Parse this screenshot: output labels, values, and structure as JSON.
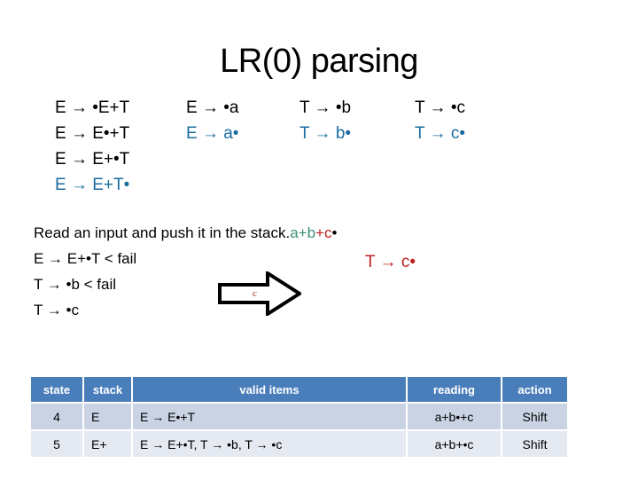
{
  "slide": {
    "title": "LR(0) parsing"
  },
  "itemsets": {
    "columns": [
      {
        "name": "column-e-items",
        "rules": [
          {
            "text": "E → •E+T",
            "color": "black"
          },
          {
            "text": "E → E•+T",
            "color": "black"
          },
          {
            "text": "E → E+•T",
            "color": "black"
          },
          {
            "text": "E → E+T•",
            "color": "blue"
          }
        ]
      },
      {
        "name": "column-a-items",
        "rules": [
          {
            "text": "E → •a",
            "color": "black"
          },
          {
            "text": "E → a•",
            "color": "blue"
          }
        ]
      },
      {
        "name": "column-b-items",
        "rules": [
          {
            "text": "T → •b",
            "color": "black"
          },
          {
            "text": "T → b•",
            "color": "blue"
          }
        ]
      },
      {
        "name": "column-c-items",
        "rules": [
          {
            "text": "T → •c",
            "color": "black"
          },
          {
            "text": "T → c•",
            "color": "blue"
          }
        ]
      }
    ]
  },
  "narrative": {
    "instruction_text": "Read an input and push it in the stack.",
    "input_tokens": [
      {
        "text": "a+b",
        "color": "green"
      },
      {
        "text": "+c",
        "color": "red"
      },
      {
        "text": "•",
        "color": "black"
      }
    ],
    "lines": [
      "E → E+•T < fail",
      "T → •b < fail",
      "T → •c"
    ],
    "right_annotation": "T → c•",
    "arrow_label": "c"
  },
  "table": {
    "headers": [
      "state",
      "stack",
      "valid items",
      "reading",
      "action"
    ],
    "rows": [
      {
        "state": "4",
        "stack": "E",
        "valid_items": "E → E•+T",
        "reading": "a+b•+c",
        "action": "Shift"
      },
      {
        "state": "5",
        "stack": "E+",
        "valid_items": "E → E+•T, T → •b, T → •c",
        "reading": "a+b+•c",
        "action": "Shift"
      }
    ]
  },
  "colors": {
    "header_blue": "#4A7EBB",
    "row_a": "#C9D3E4",
    "row_b": "#E4E9F2",
    "rule_blue": "#1B6CA0",
    "accent_red": "#BE1E1E",
    "token_green": "#3E8E77"
  }
}
